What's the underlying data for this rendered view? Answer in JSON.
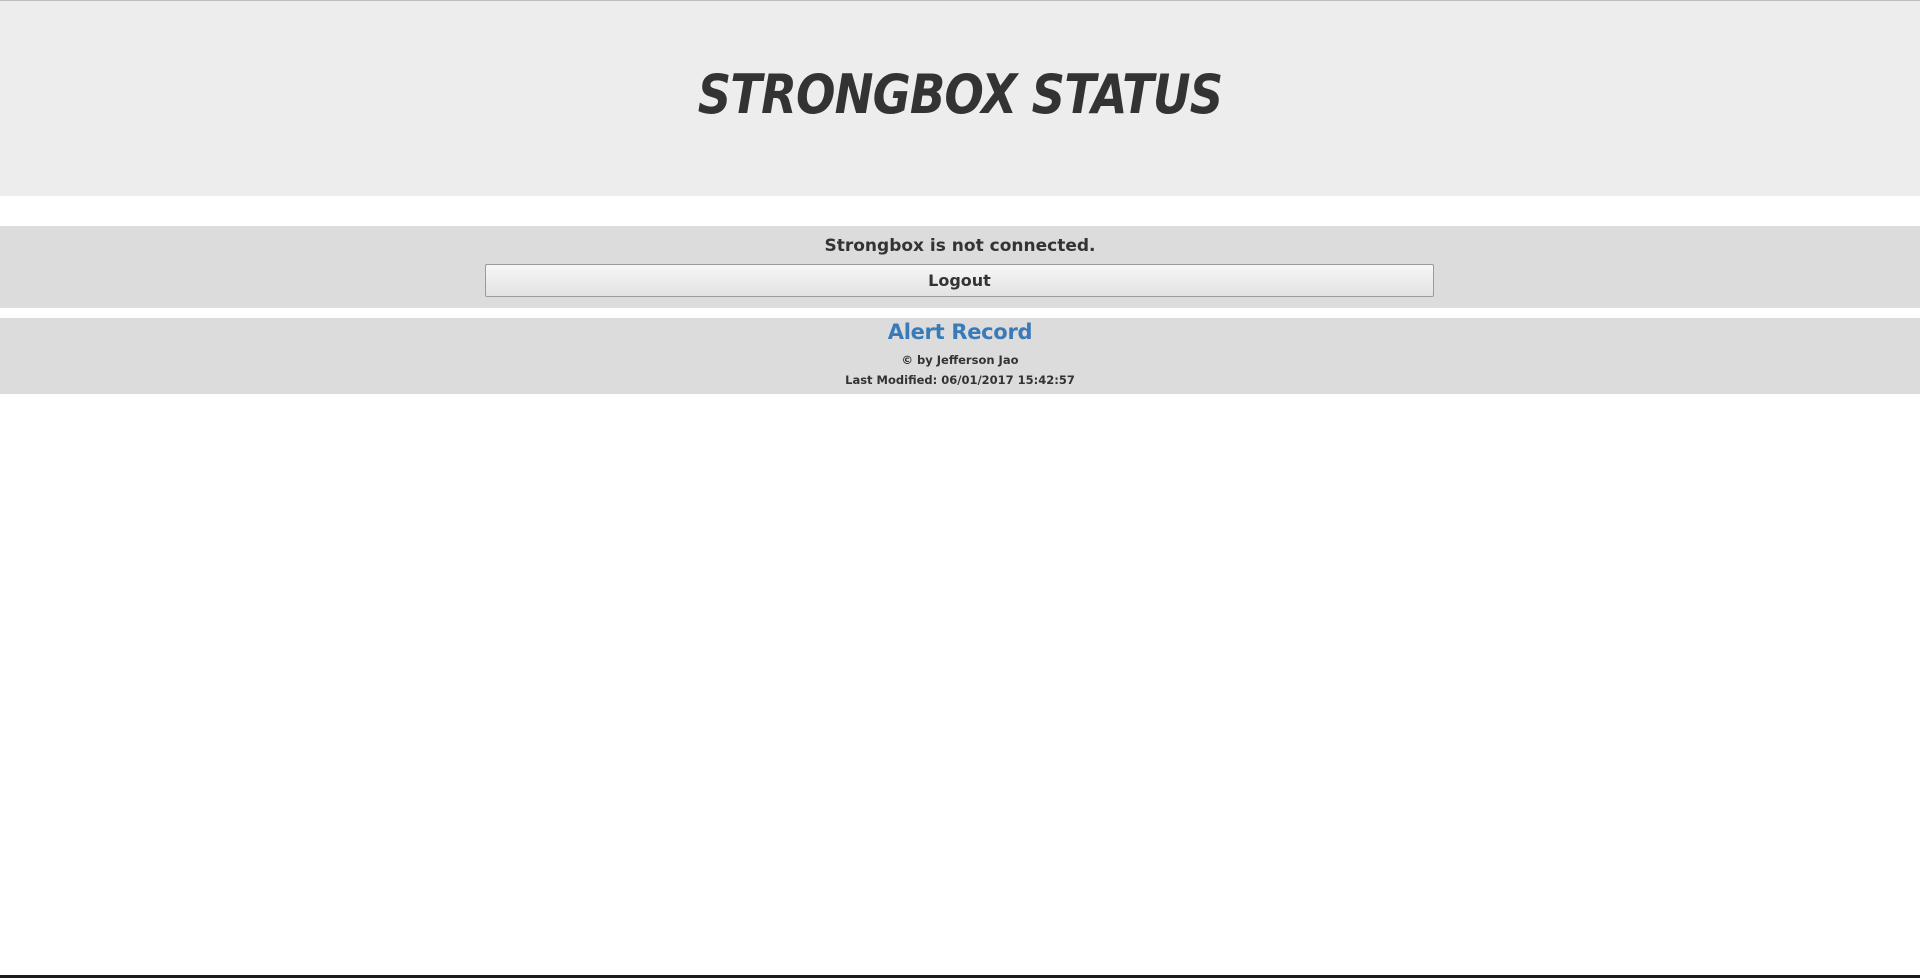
{
  "header": {
    "title": "Strongbox Status"
  },
  "status": {
    "message": "Strongbox is not connected.",
    "logout_label": "Logout"
  },
  "footer": {
    "alert_link": "Alert Record",
    "credit": "© by Jefferson Jao",
    "last_modified": "Last Modified: 06/01/2017 15:42:57"
  },
  "colors": {
    "header_bg": "#ededed",
    "section_bg": "#dcdcdc",
    "link": "#3a7ab8",
    "text": "#333333"
  }
}
